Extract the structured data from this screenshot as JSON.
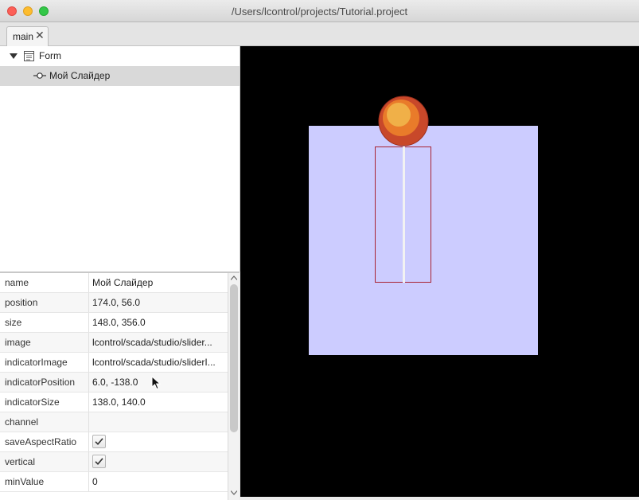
{
  "window": {
    "title": "/Users/lcontrol/projects/Tutorial.project"
  },
  "tabs": [
    {
      "label": "main",
      "close_glyph": "✕"
    }
  ],
  "tree": {
    "root": {
      "label": "Form",
      "icon": "form-icon",
      "expanded": true
    },
    "children": [
      {
        "label": "Мой Слайдер",
        "icon": "slider-component-icon",
        "selected": true
      }
    ]
  },
  "properties": [
    {
      "name": "name",
      "value": "Мой Слайдер"
    },
    {
      "name": "position",
      "value": "174.0, 56.0"
    },
    {
      "name": "size",
      "value": "148.0, 356.0"
    },
    {
      "name": "image",
      "value": "lcontrol/scada/studio/slider..."
    },
    {
      "name": "indicatorImage",
      "value": "lcontrol/scada/studio/sliderI..."
    },
    {
      "name": "indicatorPosition",
      "value": "6.0, -138.0"
    },
    {
      "name": "indicatorSize",
      "value": "138.0, 140.0"
    },
    {
      "name": "channel",
      "value": ""
    },
    {
      "name": "saveAspectRatio",
      "checked": true
    },
    {
      "name": "vertical",
      "checked": true
    },
    {
      "name": "minValue",
      "value": "0"
    }
  ],
  "colors": {
    "canvas_bg": "#000000",
    "slider_background": "#ccccff",
    "indicator_border": "#a82333",
    "knob_outer": "#c8482a",
    "knob_mid": "#e97b2a",
    "knob_inner": "#f0b048"
  }
}
